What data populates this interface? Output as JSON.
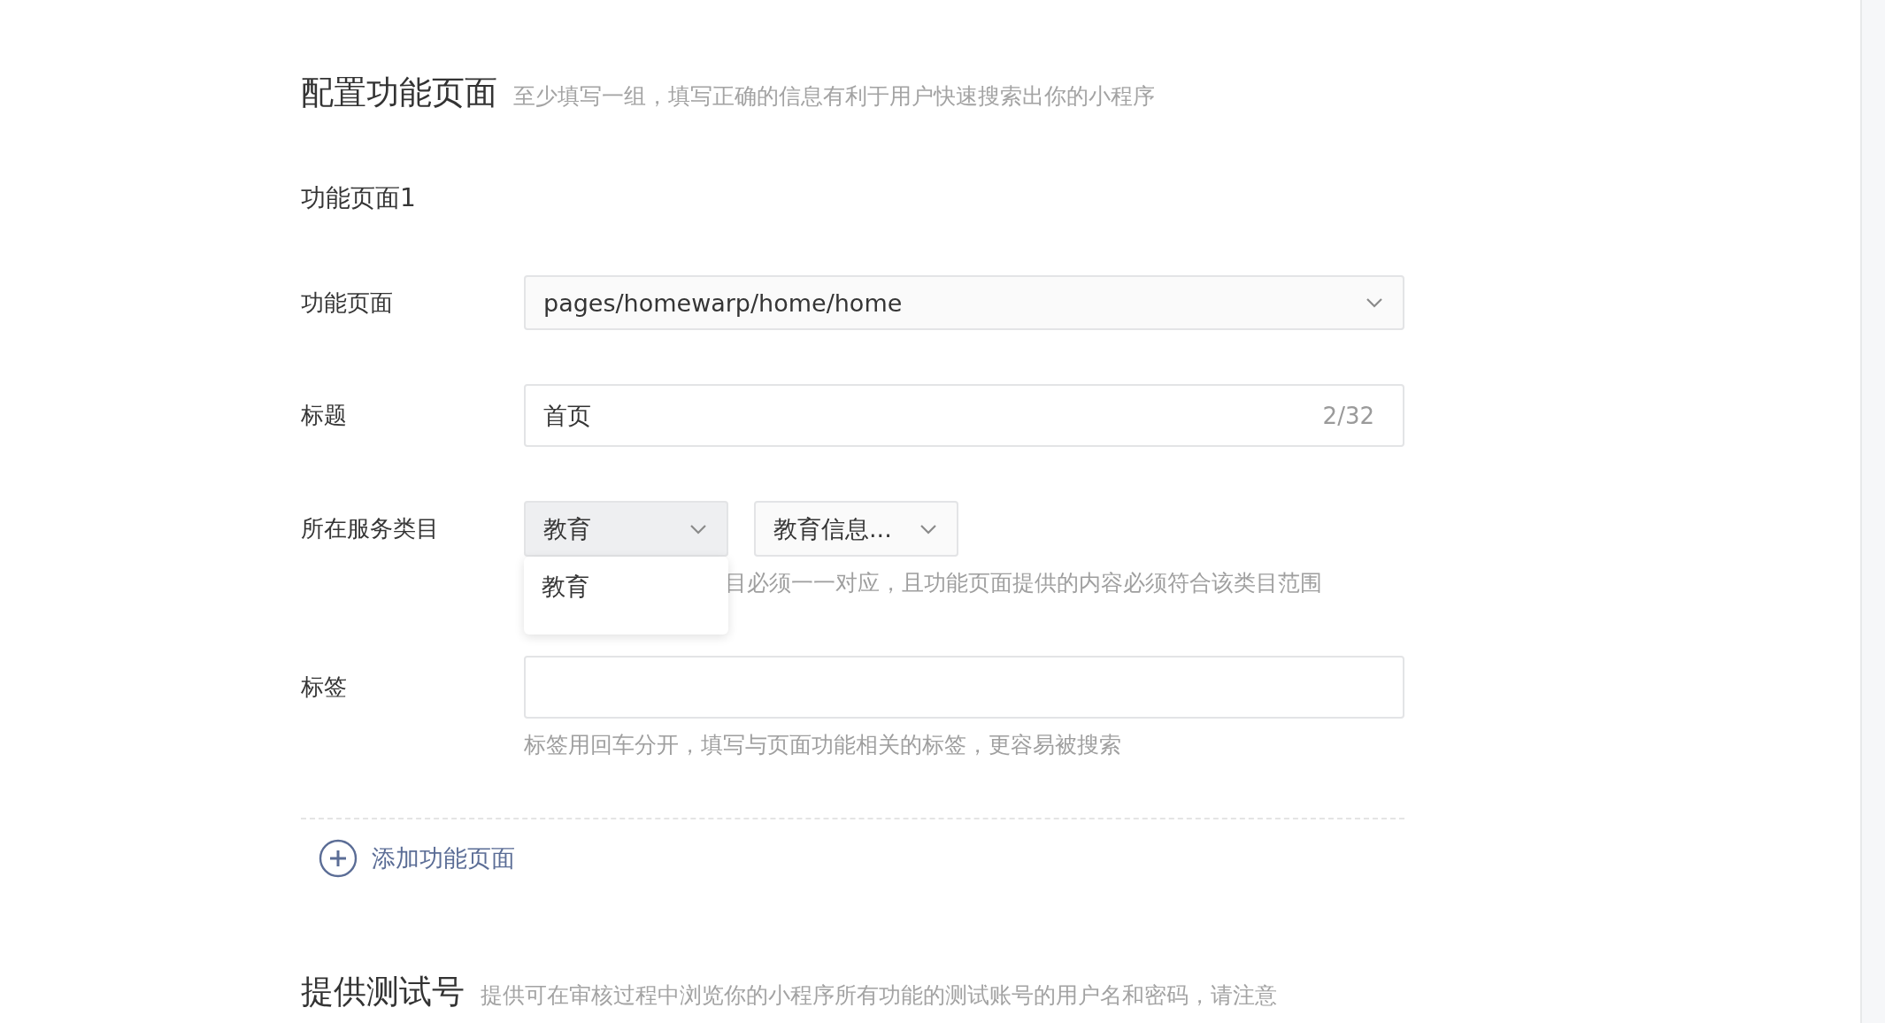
{
  "section": {
    "title": "配置功能页面",
    "hint": "至少填写一组，填写正确的信息有利于用户快速搜索出你的小程序"
  },
  "group_title": "功能页面1",
  "fields": [
    {
      "kind": "select",
      "label": "功能页面",
      "value": "pages/homewarp/home/home"
    },
    {
      "kind": "text",
      "label": "标题",
      "value": "首页",
      "counter": "2/32"
    },
    {
      "kind": "category",
      "label": "所在服务类目",
      "selects": [
        {
          "value": "教育",
          "expanded": true,
          "options": [
            {
              "label": "教育"
            }
          ]
        },
        {
          "value": "教育信息...",
          "expanded": false
        }
      ],
      "hint": "目必须一一对应，且功能页面提供的内容必须符合该类目范围"
    },
    {
      "kind": "tags",
      "label": "标签",
      "hint": "标签用回车分开，填写与页面功能相关的标签，更容易被搜索"
    }
  ],
  "add_button": "添加功能页面",
  "next_section": {
    "title": "提供测试号",
    "hint": "提供可在审核过程中浏览你的小程序所有功能的测试账号的用户名和密码，请注意"
  }
}
